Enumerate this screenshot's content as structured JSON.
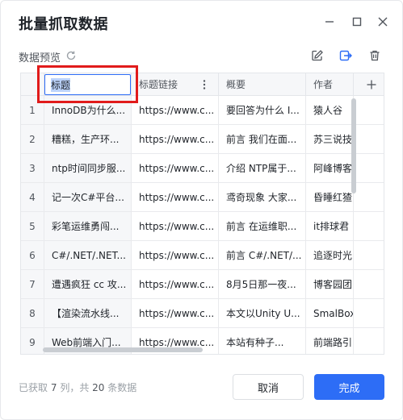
{
  "dialog": {
    "title": "批量抓取数据"
  },
  "toolbar": {
    "preview_label": "数据预览",
    "icons": [
      "refresh-icon",
      "edit-icon",
      "map-icon",
      "trash-icon"
    ]
  },
  "grid": {
    "editing_header_value": "标题",
    "headers": [
      "",
      "标题",
      "标题链接",
      "概要",
      "作者"
    ],
    "rows": [
      [
        "1",
        "InnoDB为什么...",
        "https://www.c...",
        "要回答为什么 I...",
        "猿人谷"
      ],
      [
        "2",
        "糟糕，生产环...",
        "https://www.c...",
        "前言 我们在面...",
        "苏三说技"
      ],
      [
        "3",
        "ntp时间同步服...",
        "https://www.c...",
        "介绍 NTP属于...",
        "阿峰博客"
      ],
      [
        "4",
        "记一次C#平台...",
        "https://www.c...",
        "鸢奇现象 大家...",
        "昏睡红猹"
      ],
      [
        "5",
        "彩笔运维勇闯...",
        "https://www.c...",
        "前言 在运维职...",
        "it排球君"
      ],
      [
        "6",
        "C#/.NET/.NET...",
        "https://www.c...",
        "前言 C#/.NET/...",
        "追逐时光"
      ],
      [
        "7",
        "遭遇疯狂 cc 攻...",
        "https://www.c...",
        "8月5日那一夜...",
        "博客园团"
      ],
      [
        "8",
        "【渲染流水线...",
        "https://www.c...",
        "本文以Unity U...",
        "SmalBox"
      ],
      [
        "9",
        "Web前端入门...",
        "https://www.c...",
        "本站有种子...",
        "前端路引"
      ]
    ]
  },
  "footer": {
    "summary_prefix": "已获取",
    "columns_count": "7",
    "columns_unit": "列，共",
    "rows_count": "20",
    "rows_unit": "条数据",
    "cancel_label": "取消",
    "ok_label": "完成"
  },
  "colors": {
    "accent": "#2d6df6",
    "highlight_border": "#e11b1b"
  }
}
